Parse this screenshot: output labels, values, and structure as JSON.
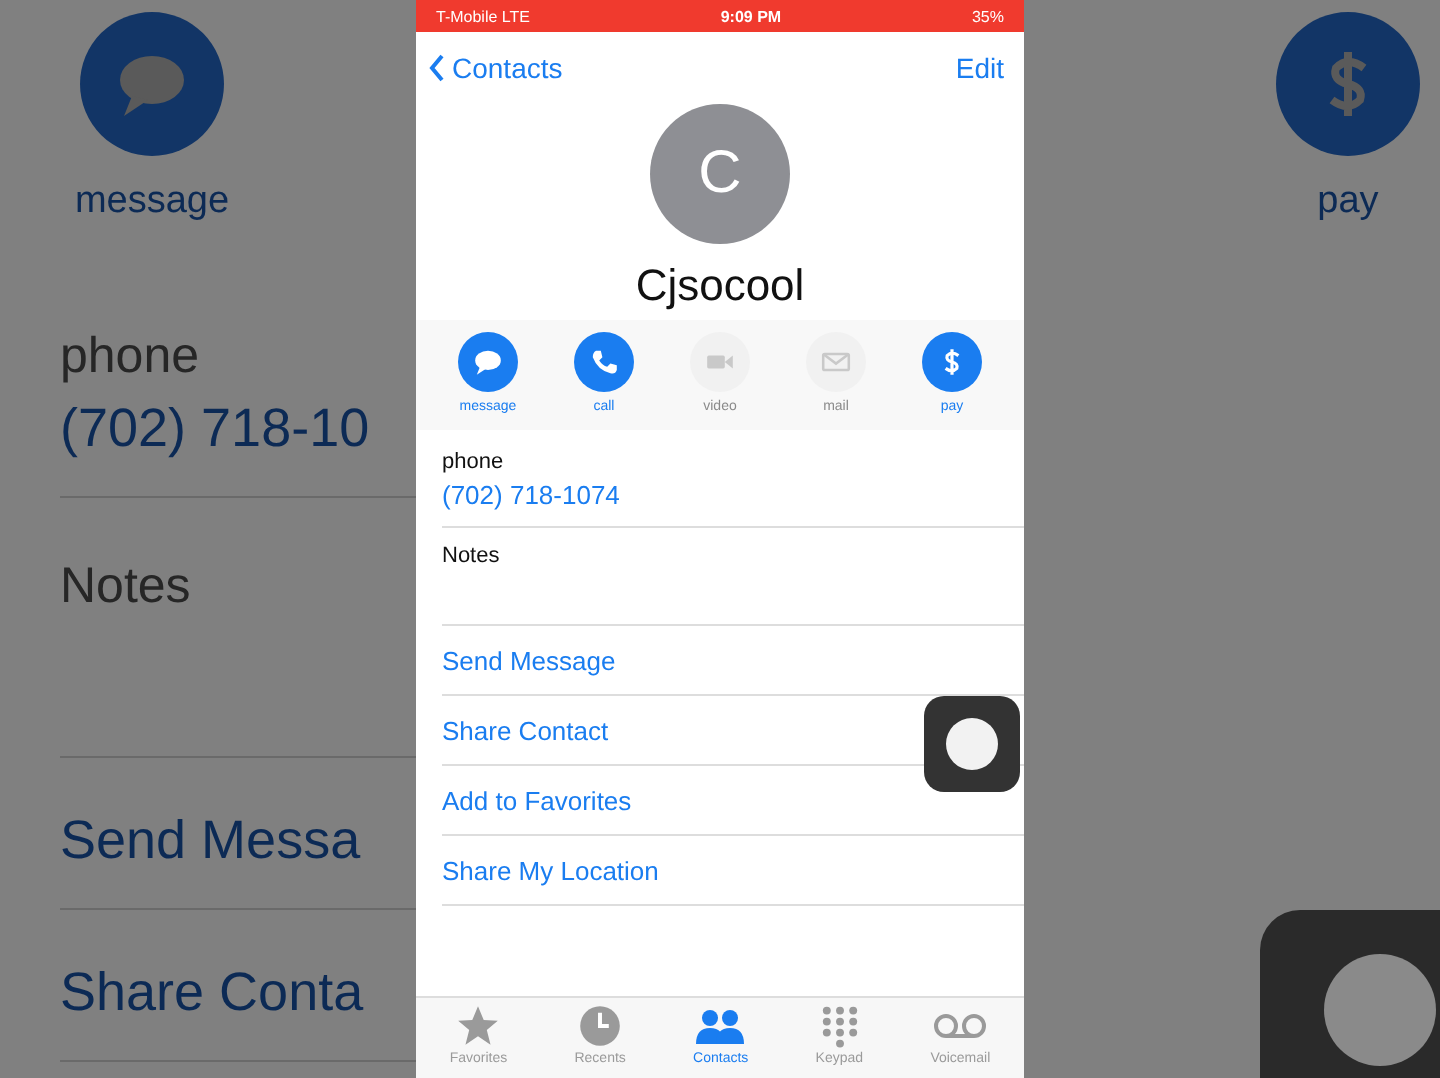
{
  "backdrop": {
    "actions": [
      {
        "label": "message",
        "kind": "message"
      },
      {
        "label": "pay",
        "kind": "pay"
      }
    ],
    "phone_label": "phone",
    "phone_number": "(702) 718-10",
    "notes_label": "Notes",
    "links": [
      "Send Messa",
      "Share Conta"
    ]
  },
  "status_bar": {
    "carrier": "T-Mobile  LTE",
    "time": "9:09 PM",
    "battery": "35%"
  },
  "nav": {
    "back": "Contacts",
    "edit": "Edit"
  },
  "contact": {
    "initial": "C",
    "name": "Cjsocool"
  },
  "actions": [
    {
      "label": "message",
      "kind": "message",
      "disabled": false
    },
    {
      "label": "call",
      "kind": "call",
      "disabled": false
    },
    {
      "label": "video",
      "kind": "video",
      "disabled": true
    },
    {
      "label": "mail",
      "kind": "mail",
      "disabled": true
    },
    {
      "label": "pay",
      "kind": "pay",
      "disabled": false
    }
  ],
  "phone": {
    "label": "phone",
    "number": "(702) 718-1074"
  },
  "notes": {
    "label": "Notes"
  },
  "links": [
    "Send Message",
    "Share Contact",
    "Add to Favorites",
    "Share My Location"
  ],
  "tabs": [
    {
      "label": "Favorites",
      "kind": "star",
      "selected": false
    },
    {
      "label": "Recents",
      "kind": "clock",
      "selected": false
    },
    {
      "label": "Contacts",
      "kind": "people",
      "selected": true
    },
    {
      "label": "Keypad",
      "kind": "keypad",
      "selected": false
    },
    {
      "label": "Voicemail",
      "kind": "voicemail",
      "selected": false
    }
  ]
}
